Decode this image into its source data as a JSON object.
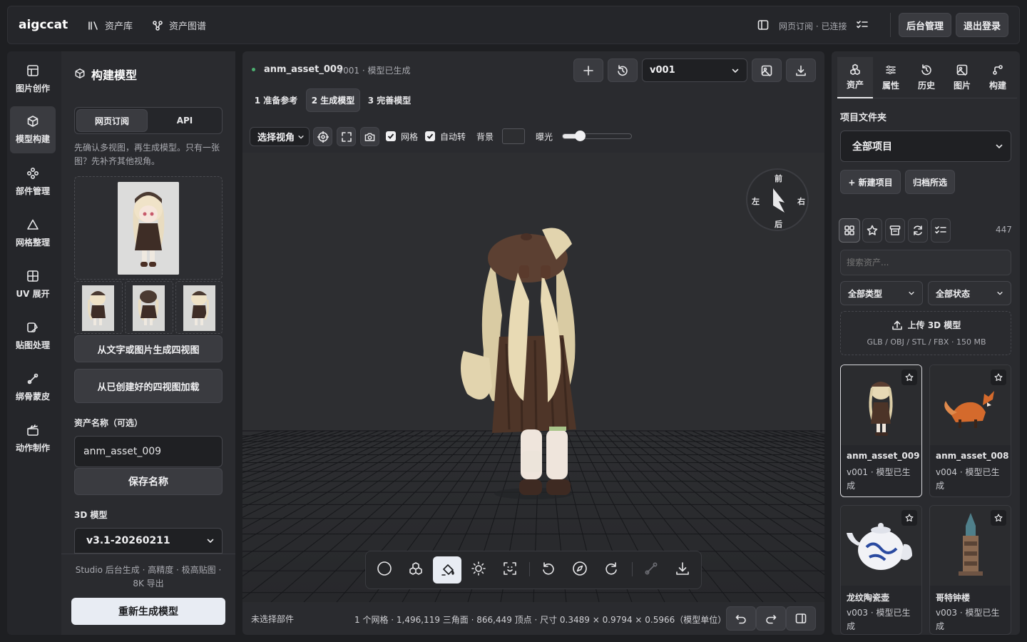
{
  "header": {
    "logo": "aigccat",
    "nav": [
      {
        "label": "资产库",
        "icon": "library-icon"
      },
      {
        "label": "资产图谱",
        "icon": "graph-icon"
      }
    ],
    "status": "网页订阅 · 已连接",
    "admin_label": "后台管理",
    "logout_label": "退出登录"
  },
  "rail": [
    {
      "label": "图片创作",
      "icon": "image-create-icon"
    },
    {
      "label": "模型构建",
      "icon": "cube-icon",
      "active": true
    },
    {
      "label": "部件管理",
      "icon": "parts-icon"
    },
    {
      "label": "网格整理",
      "icon": "mesh-icon"
    },
    {
      "label": "UV 展开",
      "icon": "uv-icon"
    },
    {
      "label": "贴图处理",
      "icon": "texture-icon"
    },
    {
      "label": "绑骨蒙皮",
      "icon": "bone-icon"
    },
    {
      "label": "动作制作",
      "icon": "clapper-icon"
    }
  ],
  "build": {
    "title": "构建模型",
    "mode_tabs": [
      "网页订阅",
      "API"
    ],
    "hint": "先确认多视图，再生成模型。只有一张图？先补齐其他视角。",
    "gen_four_view_label": "从文字或图片生成四视图",
    "load_four_view_label": "从已创建好的四视图加载",
    "asset_name_label": "资产名称（可选）",
    "asset_name_value": "anm_asset_009",
    "save_name_label": "保存名称",
    "model_label": "3D 模型",
    "model_version": "v3.1-20260211",
    "studio_note": "Studio 后台生成 · 高精度 · 极高贴图 · 8K 导出",
    "regen_label": "重新生成模型"
  },
  "viewer": {
    "asset_name": "anm_asset_009",
    "asset_status": "v001 · 模型已生成",
    "version": "v001",
    "steps": [
      "1 准备参考",
      "2 生成模型",
      "3 完善模型"
    ],
    "view_select": "选择视角",
    "grid_label": "网格",
    "autorotate_label": "自动转",
    "bg_label": "背景",
    "exposure_label": "曝光",
    "exposure_value": 0.25,
    "compass": {
      "front": "前",
      "back": "后",
      "left": "左",
      "right": "右"
    },
    "footer_left": "未选择部件",
    "footer_stats": "1 个网格 · 1,496,119 三角面 · 866,449 顶点 · 尺寸 0.3489 × 0.9794 × 0.5966（模型单位）"
  },
  "right": {
    "tabs": [
      {
        "label": "资产",
        "icon": "asset-icon"
      },
      {
        "label": "属性",
        "icon": "sliders-icon"
      },
      {
        "label": "历史",
        "icon": "history-icon"
      },
      {
        "label": "图片",
        "icon": "images-icon"
      },
      {
        "label": "构建",
        "icon": "build-icon"
      }
    ],
    "folder_label": "项目文件夹",
    "folder_value": "全部项目",
    "new_project_label": "+ 新建项目",
    "archive_label": "归档所选",
    "count": "447",
    "search_placeholder": "搜索资产...",
    "type_filter": "全部类型",
    "status_filter": "全部状态",
    "upload_title": "上传 3D 模型",
    "upload_formats": "GLB / OBJ / STL / FBX · 150 MB",
    "assets": [
      {
        "name": "anm_asset_009",
        "meta": "v001 · 模型已生成"
      },
      {
        "name": "anm_asset_008",
        "meta": "v004 · 模型已生成"
      },
      {
        "name": "龙纹陶瓷壶",
        "meta": "v003 · 模型已生成"
      },
      {
        "name": "哥特钟楼",
        "meta": "v003 · 模型已生成"
      }
    ]
  },
  "colors": {
    "accent_green": "#4caf70",
    "primary_button": "#e8ecf3"
  }
}
